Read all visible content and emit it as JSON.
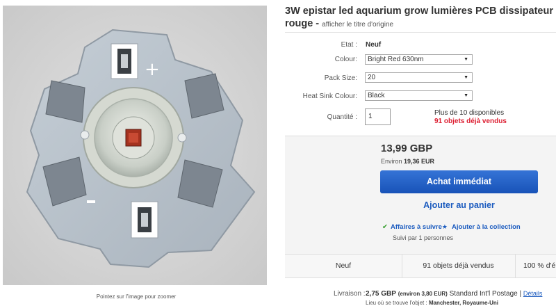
{
  "image": {
    "zoom_hint": "Pointez sur l'image pour zoomer",
    "pcb_text": "+"
  },
  "listing": {
    "title_line1": "3W epistar led aquarium grow lumières PCB dissipateur",
    "title_line2": "rouge",
    "title_sep": " - ",
    "original_title_link": "afficher le titre d'origine"
  },
  "specifics": {
    "condition_label": "Etat :",
    "condition_value": "Neuf",
    "colour_label": "Colour:",
    "colour_value": "Bright Red 630nm",
    "pack_label": "Pack Size:",
    "pack_value": "20",
    "heatsink_label": "Heat Sink Colour:",
    "heatsink_value": "Black",
    "quantity_label": "Quantité :",
    "quantity_value": "1",
    "available": "Plus de 10 disponibles",
    "sold": "91 objets déjà vendus"
  },
  "buybox": {
    "price": "13,99 GBP",
    "approx_prefix": "Environ",
    "approx_value": "19,36 EUR",
    "buy_now": "Achat immédiat",
    "add_to_cart": "Ajouter au panier",
    "watch": "Affaires à suivre",
    "add_collection": "Ajouter à la collection",
    "followers": "Suivi par 1 personnes"
  },
  "strip": {
    "condition": "Neuf",
    "sold": "91 objets déjà vendus",
    "feedback": "100 % d'é"
  },
  "shipping": {
    "label": "Livraison :",
    "cost": "2,75 GBP",
    "approx": "(environ 3,80 EUR)",
    "service": "Standard Int'l Postage",
    "sep": " | ",
    "details_link": "Détails",
    "location_label": "Lieu où se trouve l'objet :",
    "location_value": "Manchester, Royaume-Uni"
  },
  "colors": {
    "primary_button": "#1853b8",
    "link": "#1b5bbf",
    "sold_red": "#dd1e31",
    "check_green": "#2e9a26"
  }
}
